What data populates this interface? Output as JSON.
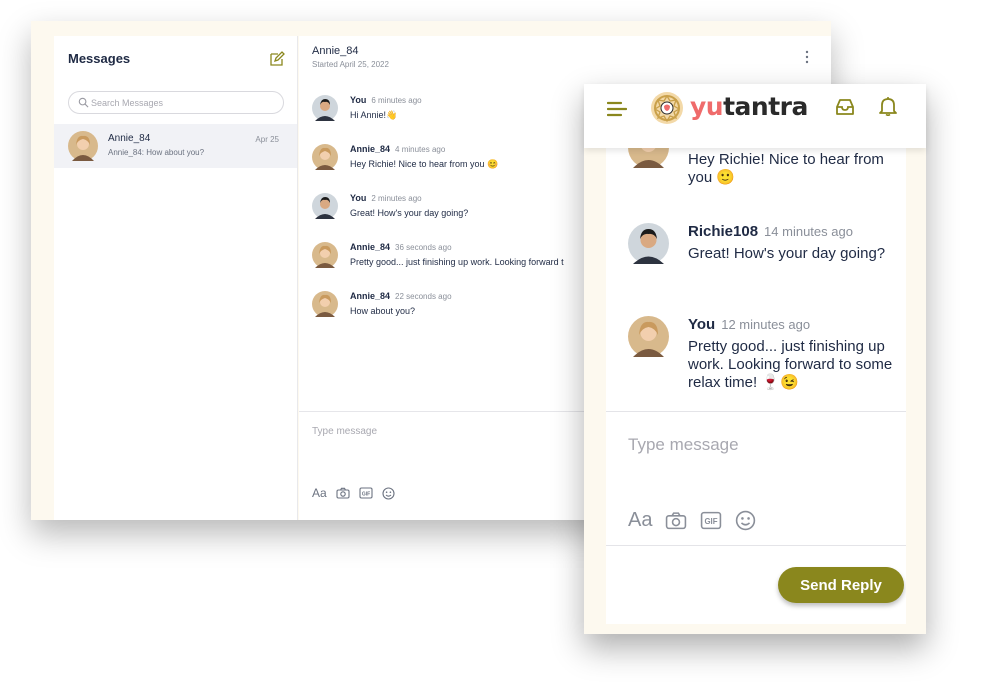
{
  "desktop": {
    "sidebar": {
      "title": "Messages",
      "search_placeholder": "Search Messages",
      "conversations": [
        {
          "name": "Annie_84",
          "preview": "Annie_84: How about you?",
          "date": "Apr 25"
        }
      ]
    },
    "conversation": {
      "name": "Annie_84",
      "started": "Started April 25, 2022",
      "messages": [
        {
          "author": "You",
          "time": "6 minutes ago",
          "text": "Hi Annie!👋"
        },
        {
          "author": "Annie_84",
          "time": "4 minutes ago",
          "text": "Hey Richie! Nice to hear from you 😊"
        },
        {
          "author": "You",
          "time": "2 minutes ago",
          "text": "Great! How's your day going?"
        },
        {
          "author": "Annie_84",
          "time": "36 seconds ago",
          "text": "Pretty good... just finishing up work. Looking forward t"
        },
        {
          "author": "Annie_84",
          "time": "22 seconds ago",
          "text": "How about you?"
        }
      ],
      "type_placeholder": "Type message",
      "tools": {
        "font_label": "Aa",
        "icons": [
          "camera-icon",
          "gif-icon",
          "emoji-icon"
        ]
      }
    }
  },
  "mobile": {
    "header": {
      "logo_text_main": "yu",
      "logo_text_tail": "tantra",
      "icons": [
        "hamburger-menu-icon",
        "inbox-icon",
        "bell-icon"
      ]
    },
    "messages": [
      {
        "author": "",
        "time": "",
        "text": "Hey Richie! Nice to hear from you 🙂"
      },
      {
        "author": "Richie108",
        "time": "14 minutes ago",
        "text": "Great! How's your day going?"
      },
      {
        "author": "You",
        "time": "12 minutes ago",
        "text": "Pretty good... just finishing up work. Looking forward to some relax time! 🍷😉"
      }
    ],
    "type_placeholder": "Type message",
    "tools": {
      "font_label": "Aa",
      "icons": [
        "camera-icon",
        "gif-icon",
        "emoji-icon"
      ]
    },
    "send_label": "Send Reply"
  },
  "colors": {
    "accent": "#8a871d",
    "logo": "#ef6b6b",
    "page_bg": "#fdf9ef",
    "text": "#1f2a44"
  }
}
